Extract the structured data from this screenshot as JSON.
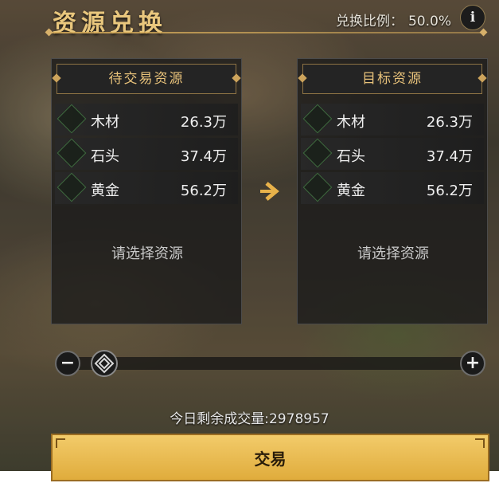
{
  "header": {
    "title": "资源兑换",
    "ratio_label": "兑换比例：",
    "ratio_value": "50.0%",
    "info_icon": "info-icon"
  },
  "source_panel": {
    "title": "待交易资源",
    "resources": [
      {
        "name": "木材",
        "amount": "26.3万"
      },
      {
        "name": "石头",
        "amount": "37.4万"
      },
      {
        "name": "黄金",
        "amount": "56.2万"
      }
    ],
    "placeholder": "请选择资源"
  },
  "target_panel": {
    "title": "目标资源",
    "resources": [
      {
        "name": "木材",
        "amount": "26.3万"
      },
      {
        "name": "石头",
        "amount": "37.4万"
      },
      {
        "name": "黄金",
        "amount": "56.2万"
      }
    ],
    "placeholder": "请选择资源"
  },
  "slider": {
    "minus_label": "−",
    "plus_label": "+"
  },
  "footer": {
    "remaining": "今日剩余成交量:2978957",
    "trade_label": "交易"
  },
  "colors": {
    "accent": "#e9c77d",
    "button": "#f2cb6a"
  }
}
